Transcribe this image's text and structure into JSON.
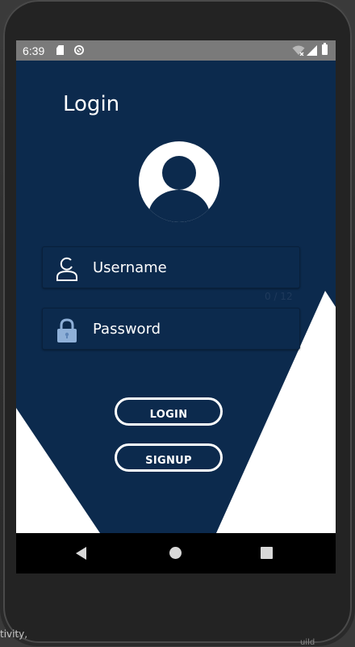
{
  "status_bar": {
    "time": "6:39",
    "icons": [
      "sd-card-icon",
      "sync-icon",
      "wifi-icon",
      "signal-icon",
      "battery-icon"
    ]
  },
  "login_screen": {
    "title": "Login",
    "avatar_icon": "user-avatar-icon",
    "username": {
      "placeholder": "Username",
      "value": "",
      "icon": "user-outline-icon",
      "counter": "0 / 12"
    },
    "password": {
      "placeholder": "Password",
      "value": "",
      "icon": "lock-icon"
    },
    "login_button_label": "LOGIN",
    "signup_button_label": "SIGNUP"
  },
  "nav_bar": {
    "icons": [
      "back-icon",
      "home-icon",
      "recents-icon"
    ]
  },
  "bezel": {
    "ide_text_left": "tivity,",
    "ide_text_right": "uild"
  },
  "colors": {
    "background": "#0c2a4d",
    "accent_shapes": "#ffffff",
    "status_bar": "#7a7a7a",
    "nav_bar": "#000000",
    "lock_icon": "#8fb0d8"
  }
}
